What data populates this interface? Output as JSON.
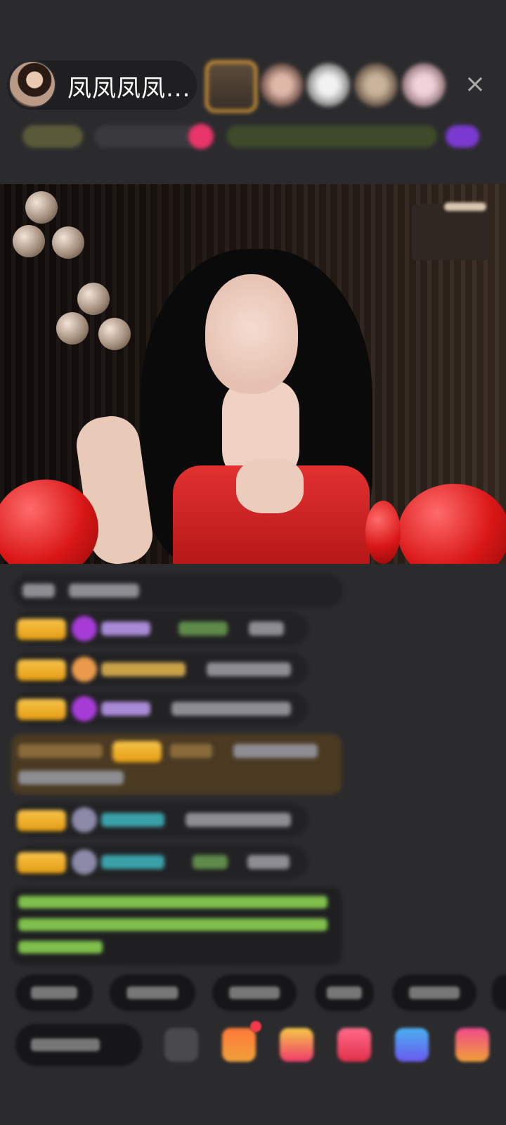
{
  "header": {
    "host_name": "凤凤凤凤...",
    "close_label": "×"
  },
  "colors": {
    "background": "#2b2b2d",
    "badge_gold": "#f1b12c",
    "balloon_red": "#d91616",
    "system_text_green": "#7fbf4a"
  },
  "icons": {
    "close": "close-icon",
    "gift": "gift-icon",
    "share": "share-icon",
    "more": "more-icon"
  }
}
